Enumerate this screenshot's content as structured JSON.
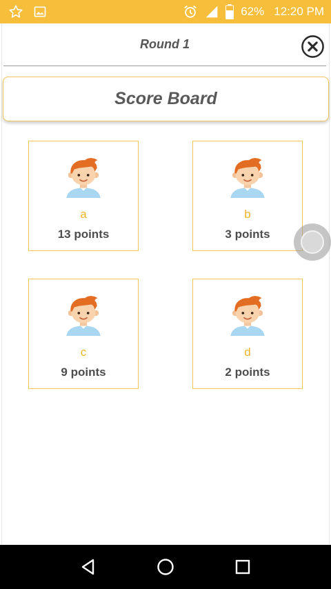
{
  "status_bar": {
    "battery_percent": "62%",
    "time": "12:20 PM",
    "background_color": "#f6be3a",
    "icons_left": [
      "star-outline-icon",
      "image-icon"
    ],
    "icons_right": [
      "alarm-icon",
      "signal-icon",
      "battery-icon"
    ]
  },
  "header": {
    "title": "Round 1",
    "close_icon": "close-circle-icon"
  },
  "scoreboard": {
    "title": "Score Board"
  },
  "players": [
    {
      "name": "a",
      "points": "13 points"
    },
    {
      "name": "b",
      "points": "3 points"
    },
    {
      "name": "c",
      "points": "9 points"
    },
    {
      "name": "d",
      "points": "2 points"
    }
  ],
  "colors": {
    "accent": "#f6be3a",
    "card_border": "#f2c55b",
    "player_name": "#f0b429"
  },
  "nav_bar": {
    "icons": [
      "back-icon",
      "home-icon",
      "recents-icon"
    ]
  }
}
